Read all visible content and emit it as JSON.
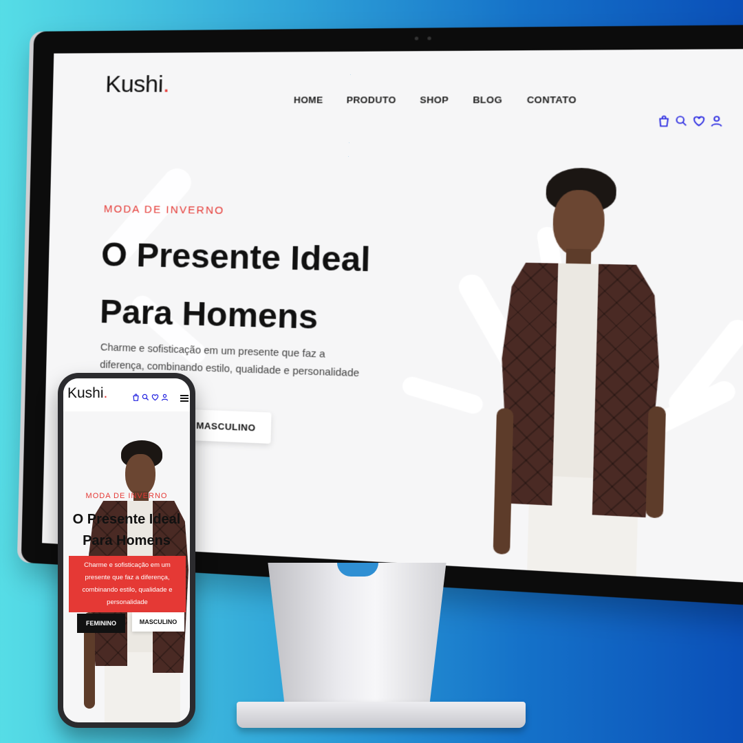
{
  "brand": {
    "logo_text": "Kushi",
    "logo_dot": ".",
    "accent": "#e53935",
    "icon_color": "#2323e0"
  },
  "desktop": {
    "nav": [
      "HOME",
      "PRODUTO",
      "SHOP",
      "BLOG",
      "CONTATO"
    ],
    "header_icons": [
      "bag-icon",
      "search-icon",
      "heart-icon",
      "user-icon"
    ],
    "hero": {
      "kicker": "MODA DE INVERNO",
      "title_line1": "O Presente Ideal",
      "title_line2": "Para Homens",
      "description": "Charme e sofisticação em um presente que faz a diferença, combinando estilo, qualidade e personalidade",
      "button_masculino": "MASCULINO"
    }
  },
  "mobile": {
    "header_icons": [
      "bag-icon",
      "search-icon",
      "heart-icon",
      "user-icon",
      "menu-icon"
    ],
    "hero": {
      "kicker": "MODA DE INVERNO",
      "title_line1": "O Presente Ideal",
      "title_line2": "Para Homens",
      "description": "Charme e sofisticação em um presente que faz a diferença, combinando estilo, qualidade e personalidade",
      "button_feminino": "FEMININO",
      "button_masculino": "MASCULINO"
    }
  }
}
